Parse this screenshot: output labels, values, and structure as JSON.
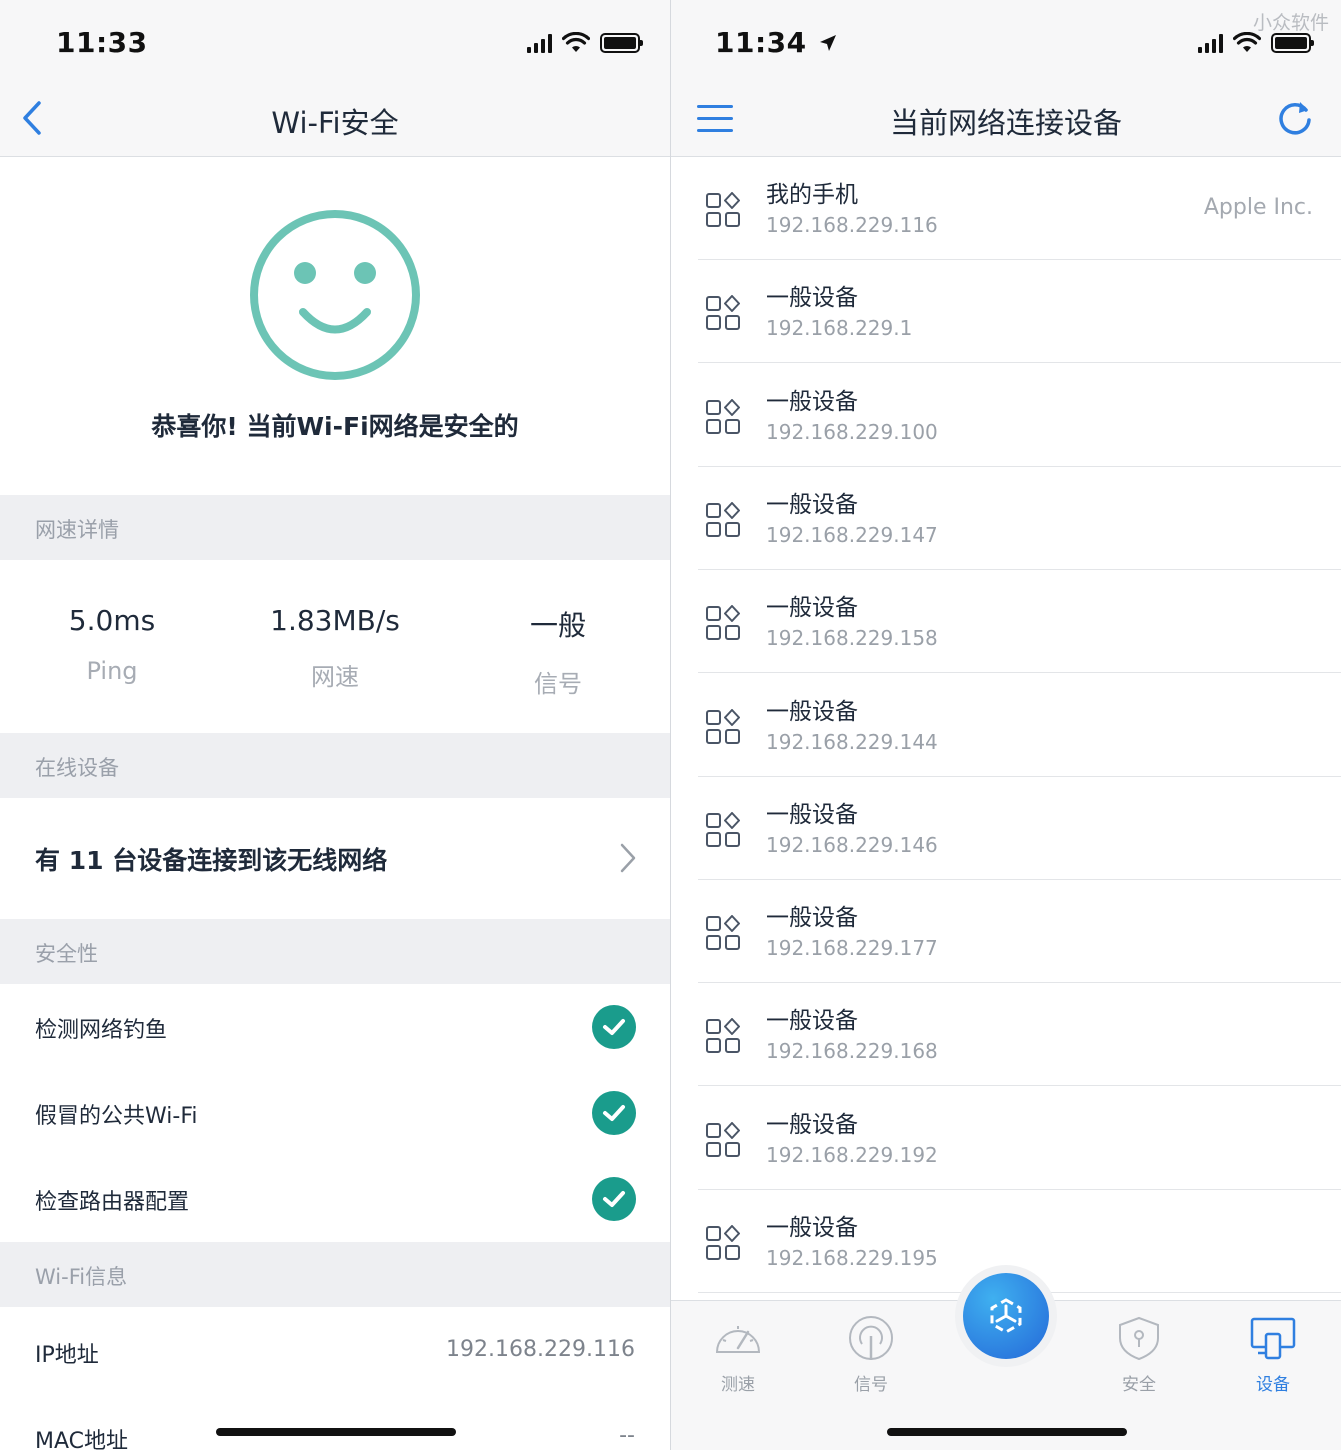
{
  "left": {
    "status": {
      "time": "11:33"
    },
    "nav": {
      "title": "Wi-Fi安全"
    },
    "hero": {
      "message": "恭喜你! 当前Wi-Fi网络是安全的"
    },
    "speed_section": {
      "title": "网速详情",
      "stats": [
        {
          "value": "5.0ms",
          "label": "Ping"
        },
        {
          "value": "1.83MB/s",
          "label": "网速"
        },
        {
          "value": "一般",
          "label": "信号"
        }
      ]
    },
    "online_section": {
      "title": "在线设备",
      "summary": "有 11 台设备连接到该无线网络"
    },
    "security_section": {
      "title": "安全性",
      "checks": [
        {
          "label": "检测网络钓鱼"
        },
        {
          "label": "假冒的公共Wi-Fi"
        },
        {
          "label": "检查路由器配置"
        }
      ]
    },
    "wifi_info_section": {
      "title": "Wi-Fi信息",
      "rows": [
        {
          "key": "IP地址",
          "value": "192.168.229.116"
        },
        {
          "key": "MAC地址",
          "value": "--"
        }
      ]
    },
    "colors": {
      "accent": "#1a9c8c",
      "smiley": "#6cc4b5"
    }
  },
  "right": {
    "watermark": "小众软件",
    "status": {
      "time": "11:34"
    },
    "nav": {
      "title": "当前网络连接设备"
    },
    "devices": [
      {
        "name": "我的手机",
        "ip": "192.168.229.116",
        "vendor": "Apple Inc."
      },
      {
        "name": "一般设备",
        "ip": "192.168.229.1",
        "vendor": ""
      },
      {
        "name": "一般设备",
        "ip": "192.168.229.100",
        "vendor": ""
      },
      {
        "name": "一般设备",
        "ip": "192.168.229.147",
        "vendor": ""
      },
      {
        "name": "一般设备",
        "ip": "192.168.229.158",
        "vendor": ""
      },
      {
        "name": "一般设备",
        "ip": "192.168.229.144",
        "vendor": ""
      },
      {
        "name": "一般设备",
        "ip": "192.168.229.146",
        "vendor": ""
      },
      {
        "name": "一般设备",
        "ip": "192.168.229.177",
        "vendor": ""
      },
      {
        "name": "一般设备",
        "ip": "192.168.229.168",
        "vendor": ""
      },
      {
        "name": "一般设备",
        "ip": "192.168.229.192",
        "vendor": ""
      },
      {
        "name": "一般设备",
        "ip": "192.168.229.195",
        "vendor": ""
      }
    ],
    "tabs": [
      {
        "label": "测速",
        "icon": "speedometer-icon"
      },
      {
        "label": "信号",
        "icon": "antenna-icon"
      },
      {
        "label": "安全",
        "icon": "shield-icon"
      },
      {
        "label": "设备",
        "icon": "devices-icon",
        "active": true
      }
    ],
    "colors": {
      "accent": "#2f7fe0"
    }
  }
}
